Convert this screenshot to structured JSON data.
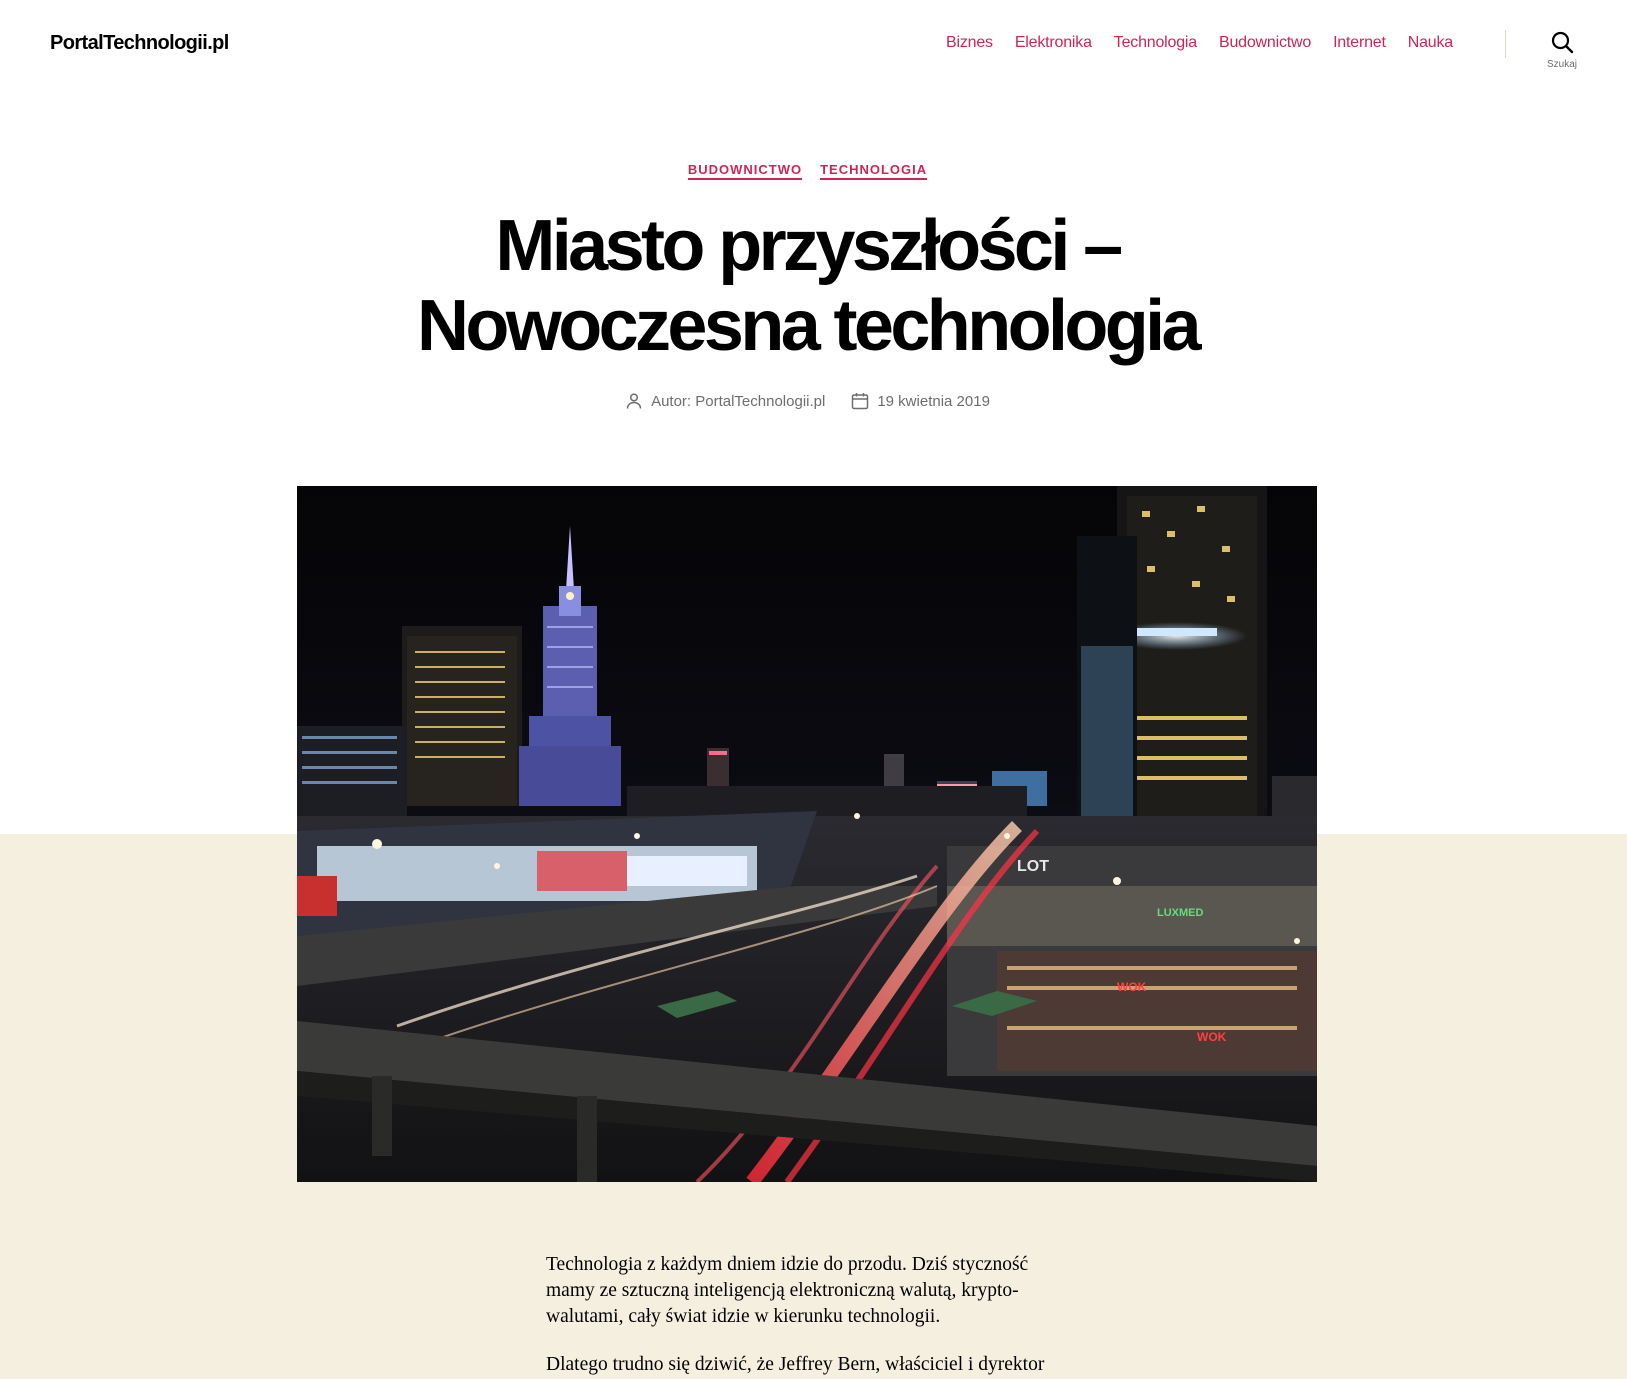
{
  "header": {
    "site_title": "PortalTechnologii.pl",
    "nav": [
      "Biznes",
      "Elektronika",
      "Technologia",
      "Budownictwo",
      "Internet",
      "Nauka"
    ],
    "search_label": "Szukaj"
  },
  "post": {
    "categories": [
      "BUDOWNICTWO",
      "TECHNOLOGIA"
    ],
    "title_line1": "Miasto przyszłości –",
    "title_line2": "Nowoczesna technologia",
    "author": "Autor: PortalTechnologii.pl",
    "date": "19 kwietnia 2019",
    "paragraphs": [
      "Technologia z każdym dniem idzie do przodu. Dziś styczność mamy ze sztuczną inteligencją elektroniczną walutą, krypto-walutami, cały świat idzie w kierunku technologii.",
      "Dlatego trudno się dziwić, że Jeffrey Bern, właściciel i dyrektor"
    ]
  },
  "image_signs": {
    "sign1": "LOT",
    "sign2": "LUXMED",
    "sign3": "WOK",
    "sign4": "WOK"
  },
  "colors": {
    "accent": "#cd2653",
    "band": "#f5efe0",
    "meta": "#6d6d6d"
  }
}
